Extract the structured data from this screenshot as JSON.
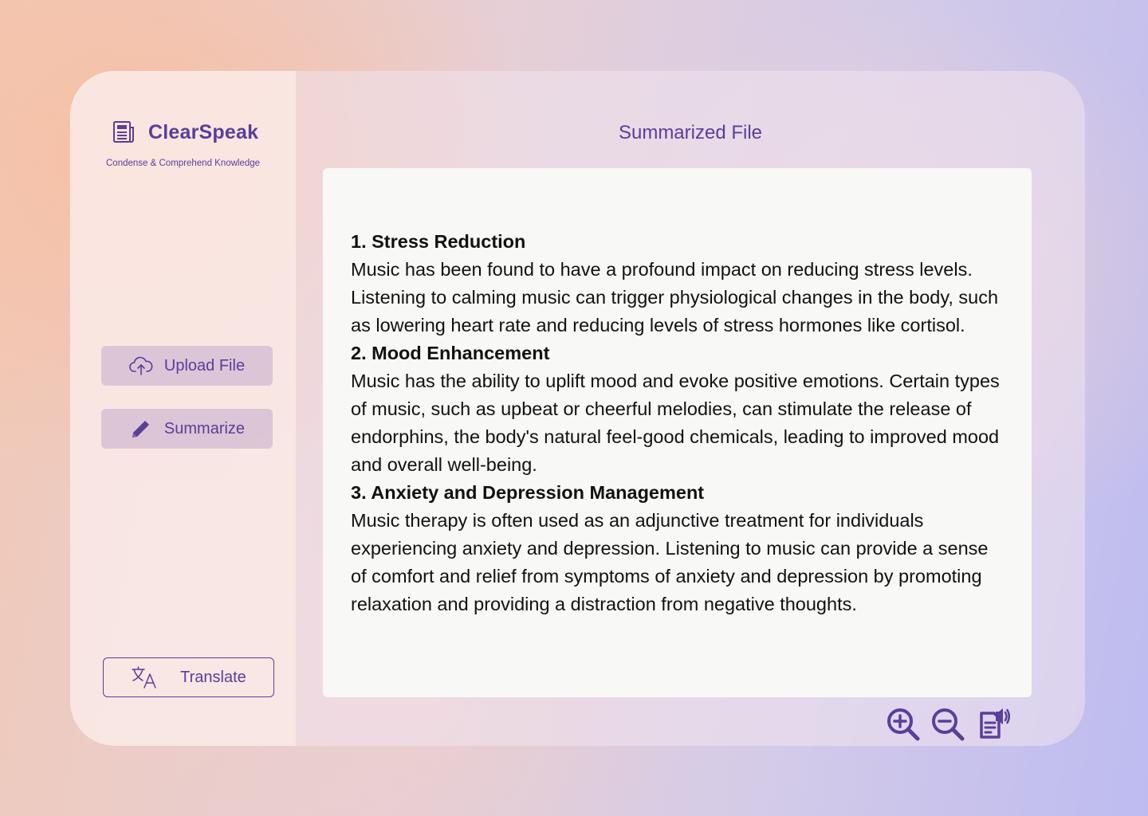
{
  "brand": {
    "name": "ClearSpeak",
    "tagline": "Condense & Comprehend Knowledge"
  },
  "sidebar": {
    "upload_label": "Upload File",
    "summarize_label": "Summarize",
    "translate_label": "Translate"
  },
  "main": {
    "title": "Summarized File",
    "sections": [
      {
        "heading": "1. Stress Reduction",
        "body": "Music has been found to have a profound impact on reducing stress levels. Listening to calming music can trigger physiological changes in the body, such as lowering heart rate and reducing levels of stress hormones like cortisol."
      },
      {
        "heading": "2. Mood Enhancement",
        "body": "Music has the ability to uplift mood and evoke positive emotions. Certain types of music, such as upbeat or cheerful melodies, can stimulate the release of endorphins, the body's natural feel-good chemicals, leading to improved mood and overall well-being."
      },
      {
        "heading": "3. Anxiety and Depression Management",
        "body": "Music therapy is often used as an adjunctive treatment for individuals experiencing anxiety and depression. Listening to music can provide a sense of comfort and relief from symptoms of anxiety and depression by promoting relaxation and providing a distraction from negative thoughts."
      }
    ]
  },
  "toolbar": {
    "icons": [
      "zoom-in-icon",
      "zoom-out-icon",
      "read-aloud-icon"
    ]
  },
  "colors": {
    "accent": "#5a3e9a",
    "document_bg": "#f8f8f7",
    "button_bg": "#cdb4d0"
  }
}
